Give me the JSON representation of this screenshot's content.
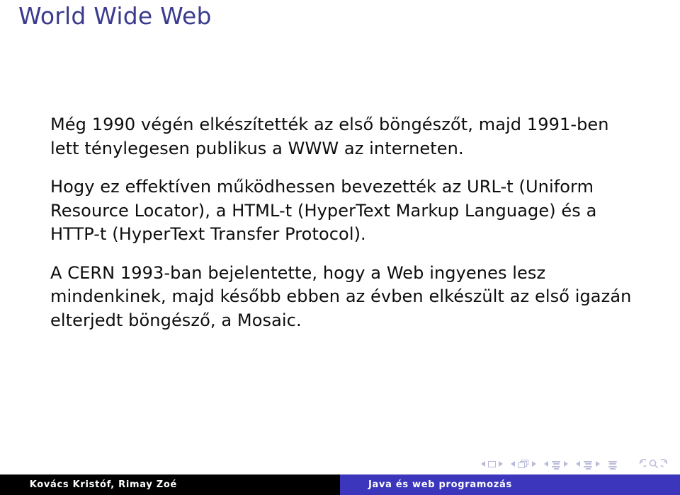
{
  "slide": {
    "title": "World Wide Web",
    "title_color": "#3b3b8f",
    "background_color": "#ffffff",
    "body": [
      {
        "id": "paragraph-browser-1990",
        "lines": [
          "Még 1990 végén elkészítették az első böngészőt, majd 1991-ben",
          "lett ténylegesen publikus a WWW az interneten."
        ]
      },
      {
        "id": "paragraph-url-html-http",
        "lines": [
          "Hogy ez effektíven működhessen bevezették az URL-t (Uniform",
          "Resource Locator), a HTML-t (HyperText Markup Language) és a",
          "HTTP-t (HyperText Transfer Protocol)."
        ]
      },
      {
        "id": "paragraph-cern-1993-mosaic",
        "lines": [
          "A CERN 1993-ban bejelentette, hogy a Web ingyenes lesz",
          "mindenkinek, majd később ebben az évben elkészült az első igazán",
          "elterjedt böngésző, a Mosaic."
        ]
      }
    ]
  },
  "navigation": {
    "color": "#b9b9d9",
    "groups": [
      {
        "name": "slide-navigation",
        "prev": "previous-slide-icon",
        "symbol": "slide-icon",
        "next": "next-slide-icon"
      },
      {
        "name": "frame-navigation",
        "prev": "previous-frame-icon",
        "symbol": "frame-icon",
        "next": "next-frame-icon"
      },
      {
        "name": "subsection-navigation",
        "prev": "previous-subsection-icon",
        "symbol": "subsection-icon",
        "next": "next-subsection-icon"
      },
      {
        "name": "section-navigation",
        "prev": "previous-section-icon",
        "symbol": "section-icon",
        "next": "next-section-icon"
      }
    ],
    "document_symbol": "document-icon",
    "back_symbol": "go-back-icon",
    "search_symbol": "search-icon",
    "forward_symbol": "go-forward-icon"
  },
  "footer": {
    "left": {
      "text": "Kovács Kristóf, Rimay Zoé",
      "background_color": "#000000",
      "text_color": "#ffffff"
    },
    "right": {
      "text": "Java és web programozás",
      "background_color": "#3b36bb",
      "text_color": "#ffffff"
    }
  }
}
